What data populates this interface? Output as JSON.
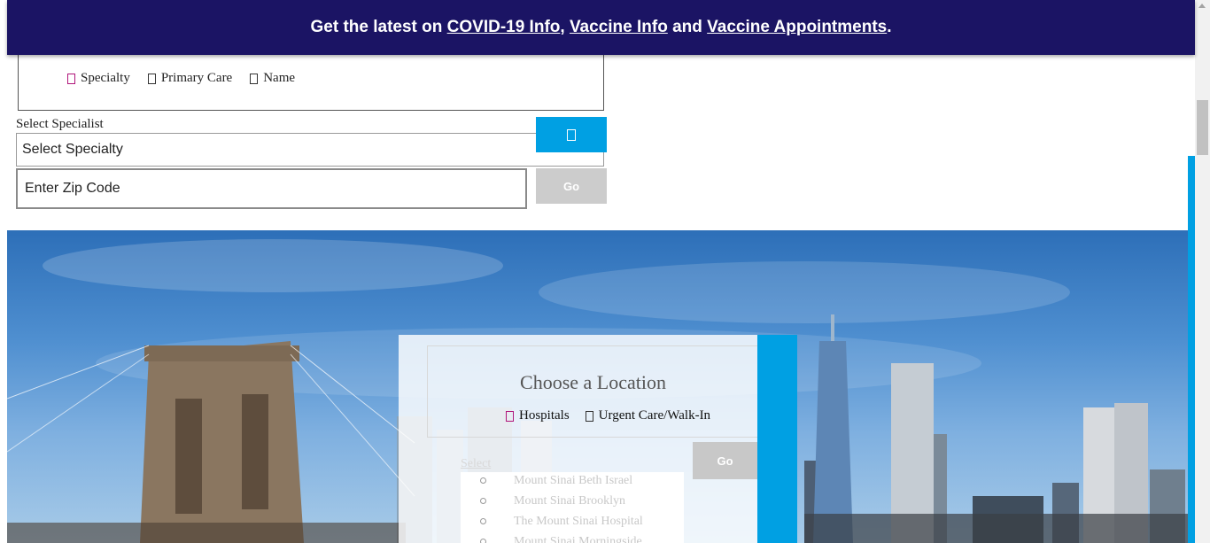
{
  "banner": {
    "prefix": "Get the latest on ",
    "link1": "COVID-19 Info",
    "comma": ", ",
    "link2": "Vaccine Info",
    "and": " and ",
    "link3": "Vaccine Appointments",
    "suffix": "."
  },
  "search_type": {
    "options": [
      "Specialty",
      "Primary Care",
      "Name"
    ],
    "selected": "Specialty"
  },
  "specialist": {
    "label": "Select Specialist",
    "select_value": "Select Specialty",
    "zip_placeholder": "Enter Zip Code",
    "go_label": "Go"
  },
  "location": {
    "title": "Choose a Location",
    "options": [
      "Hospitals",
      "Urgent Care/Walk-In"
    ],
    "selected": "Hospitals",
    "select_label": "Select",
    "go_label": "Go",
    "list": [
      "Mount Sinai Beth Israel",
      "Mount Sinai Brooklyn",
      "The Mount Sinai Hospital",
      "Mount Sinai Morningside"
    ]
  },
  "colors": {
    "banner_bg": "#1b1464",
    "accent": "#00a0e3",
    "button_disabled": "#cccccc",
    "radio_selected": "#b0157a"
  }
}
